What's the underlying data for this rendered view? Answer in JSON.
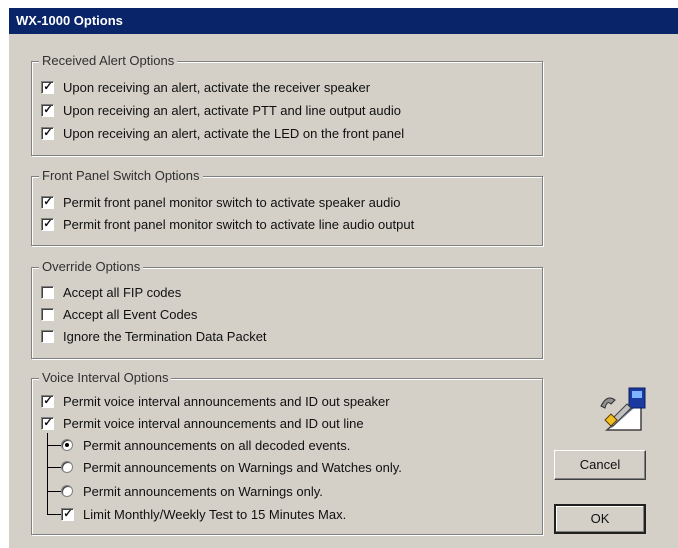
{
  "window": {
    "title": "WX-1000 Options"
  },
  "received_alert": {
    "legend": "Received Alert Options",
    "options": [
      {
        "label": "Upon receiving an alert, activate the receiver speaker",
        "checked": true
      },
      {
        "label": "Upon receiving an alert, activate PTT and line output audio",
        "checked": true
      },
      {
        "label": "Upon receiving an alert, activate the LED on the front panel",
        "checked": true
      }
    ]
  },
  "front_panel": {
    "legend": "Front Panel Switch Options",
    "options": [
      {
        "label": "Permit front panel monitor switch to activate speaker audio",
        "checked": true
      },
      {
        "label": "Permit front panel monitor switch to activate line audio output",
        "checked": true
      }
    ]
  },
  "override": {
    "legend": "Override Options",
    "options": [
      {
        "label": "Accept all FIP codes",
        "checked": false
      },
      {
        "label": "Accept all Event Codes",
        "checked": false
      },
      {
        "label": "Ignore the Termination Data Packet",
        "checked": false
      }
    ]
  },
  "voice_interval": {
    "legend": "Voice Interval Options",
    "options": [
      {
        "label": "Permit voice interval announcements and ID out speaker",
        "checked": true
      },
      {
        "label": "Permit voice interval announcements and ID out line",
        "checked": true
      }
    ],
    "radios": [
      {
        "label": "Permit announcements on all decoded events.",
        "selected": true
      },
      {
        "label": "Permit announcements on Warnings and Watches only.",
        "selected": false
      },
      {
        "label": "Permit announcements on Warnings only.",
        "selected": false
      }
    ],
    "limit": {
      "label": "Limit Monthly/Weekly Test to 15 Minutes Max.",
      "checked": true
    }
  },
  "buttons": {
    "cancel": "Cancel",
    "ok": "OK"
  },
  "icons": {
    "settings": "settings-wrench-icon"
  },
  "colors": {
    "titlebar": "#0a246a",
    "dialog": "#d4d0c8"
  }
}
